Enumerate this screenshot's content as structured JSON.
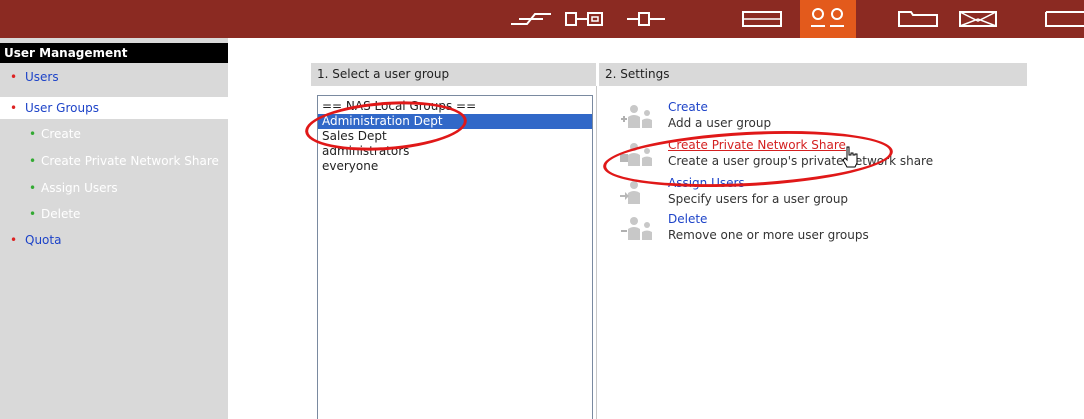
{
  "topbar": {
    "icons": [
      "network-icon",
      "hardware-icon",
      "system-icon",
      "storage-icon",
      "users-icon",
      "folder-icon",
      "mail-icon",
      "more-icon"
    ],
    "active_icon": "users-icon",
    "bg_color": "#8b2a22",
    "active_color": "#e35a1c"
  },
  "sidebar": {
    "title": "User Management",
    "items": [
      {
        "label": "Users"
      },
      {
        "label": "User Groups"
      },
      {
        "label": "Create"
      },
      {
        "label": "Create Private Network Share"
      },
      {
        "label": "Assign Users"
      },
      {
        "label": "Delete"
      },
      {
        "label": "Quota"
      }
    ]
  },
  "main": {
    "step1_heading": "1. Select a user group",
    "step2_heading": "2. Settings",
    "groups": [
      "== NAS Local Groups ==",
      "Administration Dept",
      "Sales Dept",
      "administrators",
      "everyone"
    ],
    "selected_group": "Administration Dept",
    "actions": [
      {
        "title": "Create",
        "desc": "Add a user group"
      },
      {
        "title": "Create Private Network Share",
        "desc": "Create a user group's private network share"
      },
      {
        "title": "Assign Users",
        "desc": "Specify users for a user group"
      },
      {
        "title": "Delete",
        "desc": "Remove one or more user groups"
      }
    ]
  }
}
